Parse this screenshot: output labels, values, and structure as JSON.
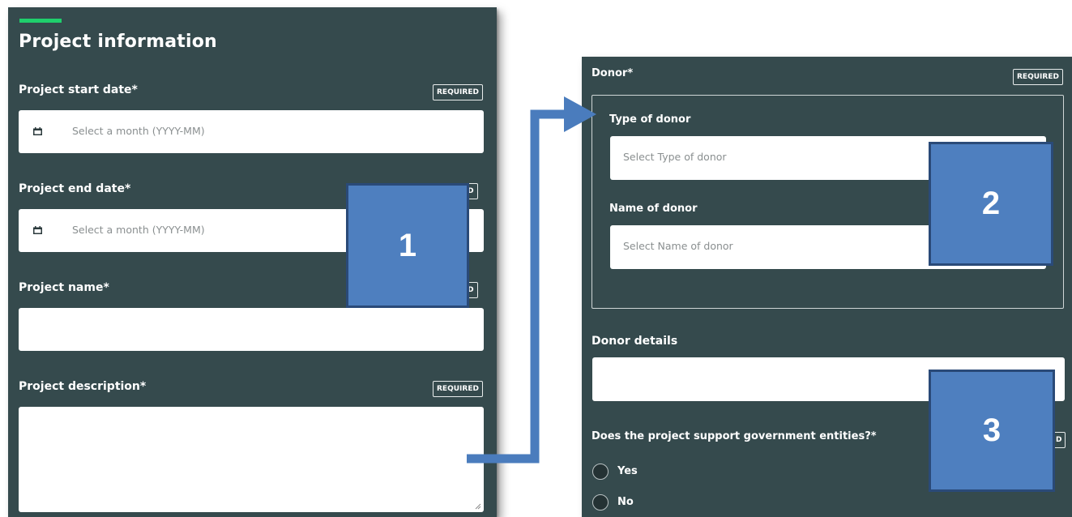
{
  "left_form": {
    "title": "Project information",
    "start_date": {
      "label": "Project start date*",
      "badge": "REQUIRED",
      "placeholder": "Select a month (YYYY-MM)"
    },
    "end_date": {
      "label": "Project end date*",
      "badge": "ED",
      "placeholder": "Select a month (YYYY-MM)"
    },
    "name": {
      "label": "Project name*",
      "badge": "ED",
      "value": ""
    },
    "description": {
      "label": "Project description*",
      "badge": "REQUIRED",
      "value": ""
    }
  },
  "right_form": {
    "donor": {
      "label": "Donor*",
      "badge": "REQUIRED",
      "type_label": "Type of donor",
      "type_placeholder": "Select Type of donor",
      "name_label": "Name of donor",
      "name_placeholder": "Select Name of donor"
    },
    "details": {
      "label": "Donor details",
      "value": ""
    },
    "government": {
      "label": "Does the project support government entities?*",
      "badge": "D",
      "options": [
        "Yes",
        "No"
      ]
    }
  },
  "callouts": [
    "1",
    "2",
    "3"
  ],
  "icons": {
    "calendar": "calendar-icon"
  },
  "colors": {
    "panel_bg": "#354a4d",
    "accent": "#1fcf6c",
    "callout_fill": "#4e7fbf",
    "callout_border": "#2a4a78",
    "arrow": "#4a7cbd"
  }
}
